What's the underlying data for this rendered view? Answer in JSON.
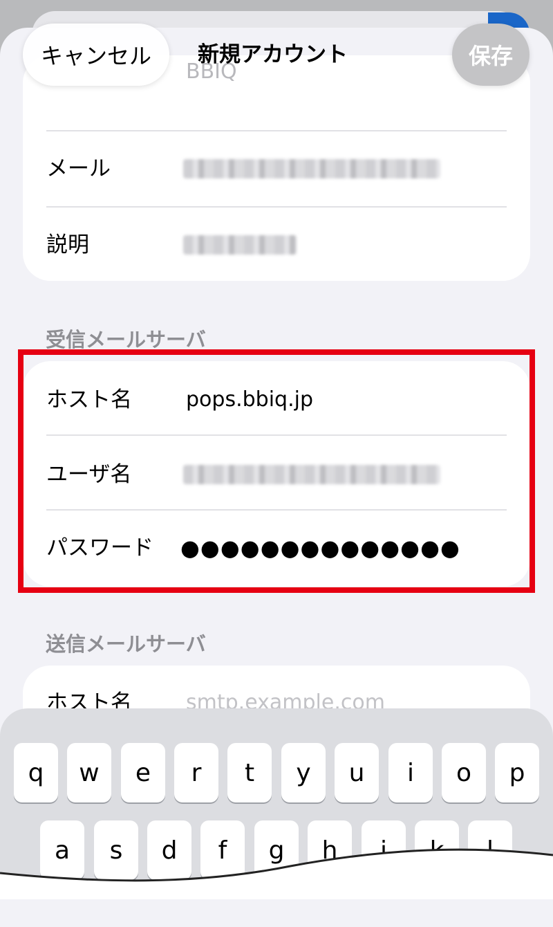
{
  "nav": {
    "cancel_label": "キャンセル",
    "title": "新規アカウント",
    "save_label": "保存"
  },
  "account": {
    "top_row_value": "BBIQ",
    "rows": [
      {
        "label": "メール",
        "value_hidden": true
      },
      {
        "label": "説明",
        "value_hidden": true
      }
    ]
  },
  "incoming": {
    "section_title": "受信メールサーバ",
    "host_label": "ホスト名",
    "host_value": "pops.bbiq.jp",
    "user_label": "ユーザ名",
    "password_label": "パスワード",
    "password_value": "●●●●●●●●●●●●●●"
  },
  "outgoing": {
    "section_title": "送信メールサーバ",
    "host_label": "ホスト名",
    "host_placeholder": "smtp.example.com"
  },
  "keyboard": {
    "row1": [
      "q",
      "w",
      "e",
      "r",
      "t",
      "y",
      "u",
      "i",
      "o",
      "p"
    ],
    "row2": [
      "a",
      "s",
      "d",
      "f",
      "g",
      "h",
      "j",
      "k",
      "l"
    ]
  },
  "colors": {
    "highlight": "#e60012",
    "section_title": "#8e8e93",
    "sheet_bg": "#f2f2f7"
  }
}
